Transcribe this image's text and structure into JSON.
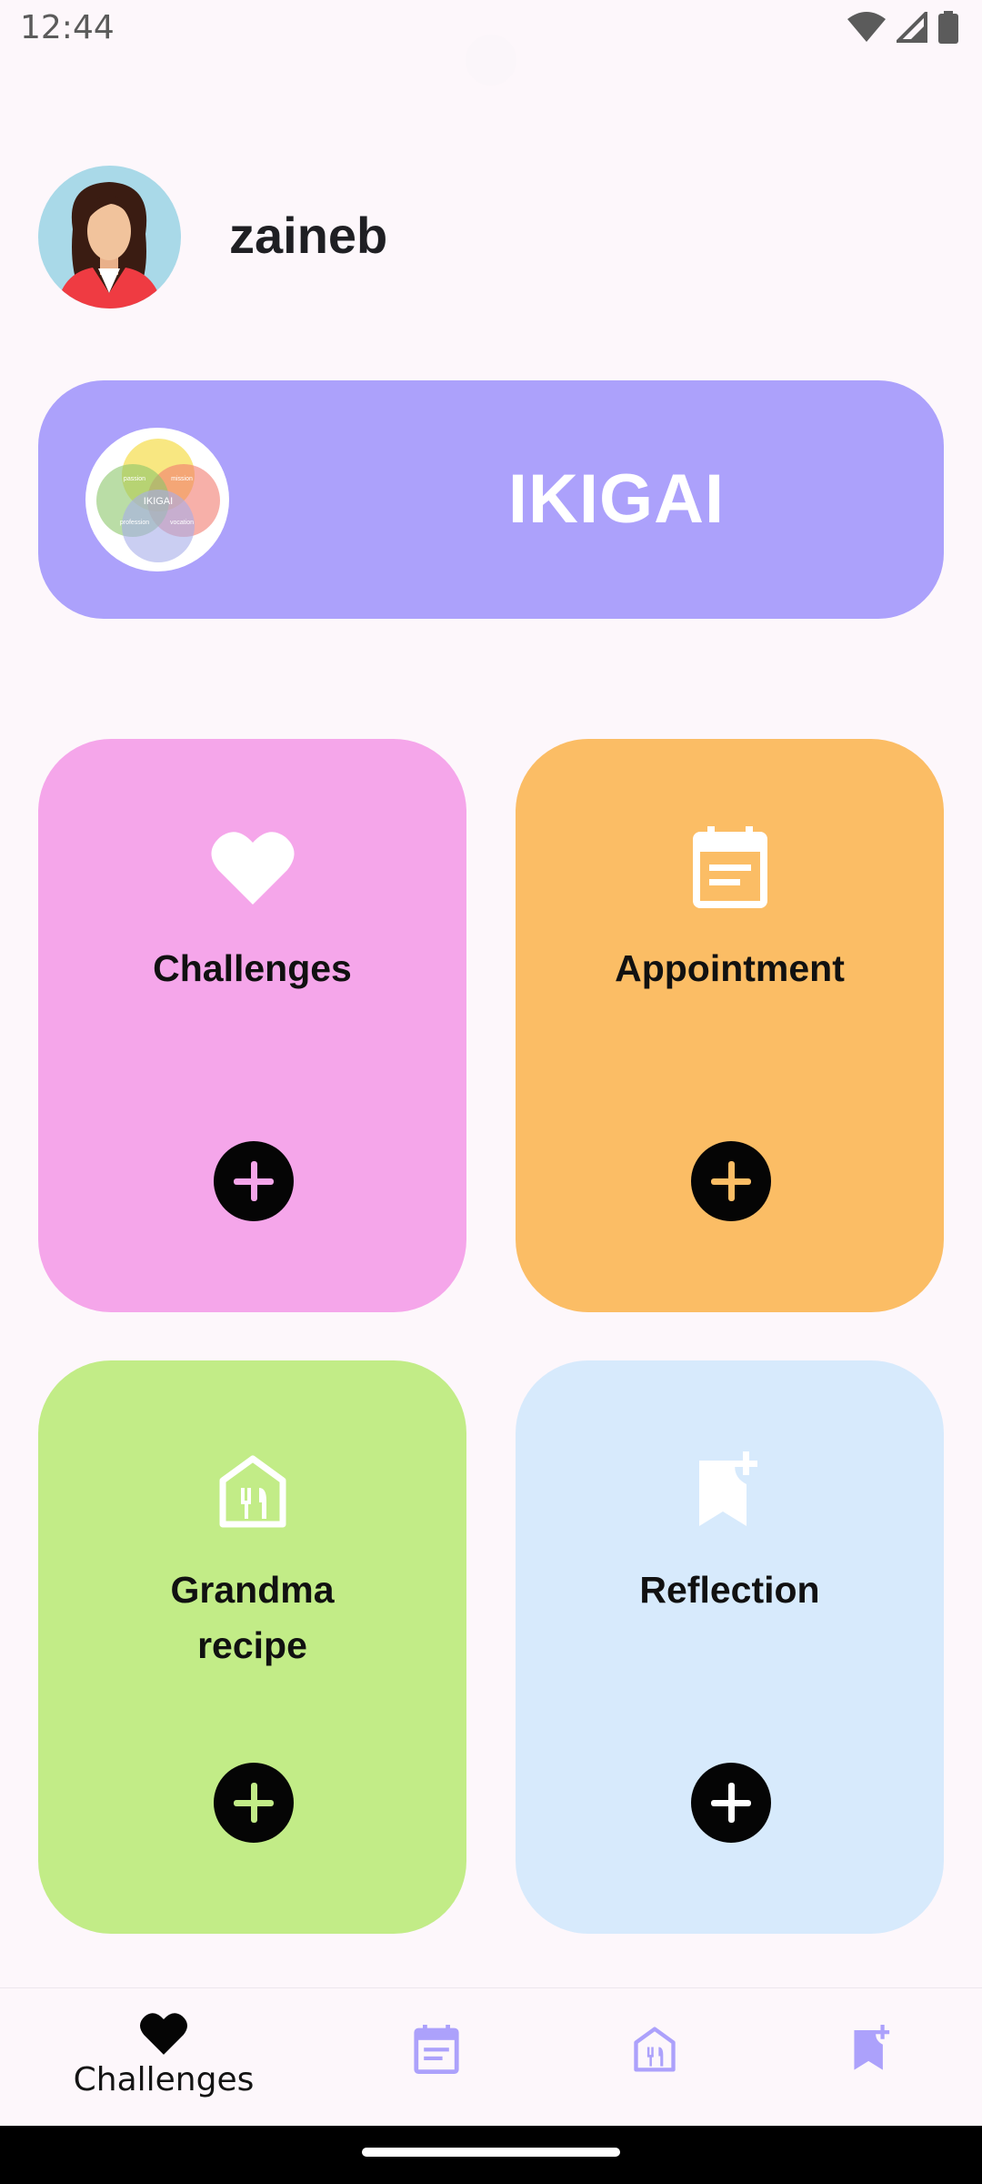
{
  "status_bar": {
    "time": "12:44"
  },
  "profile": {
    "username": "zaineb"
  },
  "ikigai_banner": {
    "title": "IKIGAI",
    "logo_text": {
      "center": "IKIGAI",
      "top_left": "passion",
      "top_right": "mission",
      "bottom_left": "profession",
      "bottom_right": "vocation"
    }
  },
  "cards": [
    {
      "title": "Challenges",
      "color": "#f5a6ea",
      "icon": "heart-icon",
      "plus_color": "#f5a6ea"
    },
    {
      "title": "Appointment",
      "color": "#fbbd65",
      "icon": "calendar-icon",
      "plus_color": "#fbbd65"
    },
    {
      "title_line1": "Grandma",
      "title_line2": "recipe",
      "color": "#c2ec87",
      "icon": "restaurant-icon",
      "plus_color": "#c2ec87"
    },
    {
      "title": "Reflection",
      "color": "#d7eafc",
      "icon": "bookmark-add-icon",
      "plus_color": "#ffffff"
    }
  ],
  "bottom_nav": {
    "items": [
      {
        "label": "Challenges",
        "icon": "heart-icon",
        "active": true
      },
      {
        "label": "",
        "icon": "calendar-icon",
        "active": false
      },
      {
        "label": "",
        "icon": "restaurant-icon",
        "active": false
      },
      {
        "label": "",
        "icon": "bookmark-add-icon",
        "active": false
      }
    ],
    "accent": "#aca1fb"
  }
}
